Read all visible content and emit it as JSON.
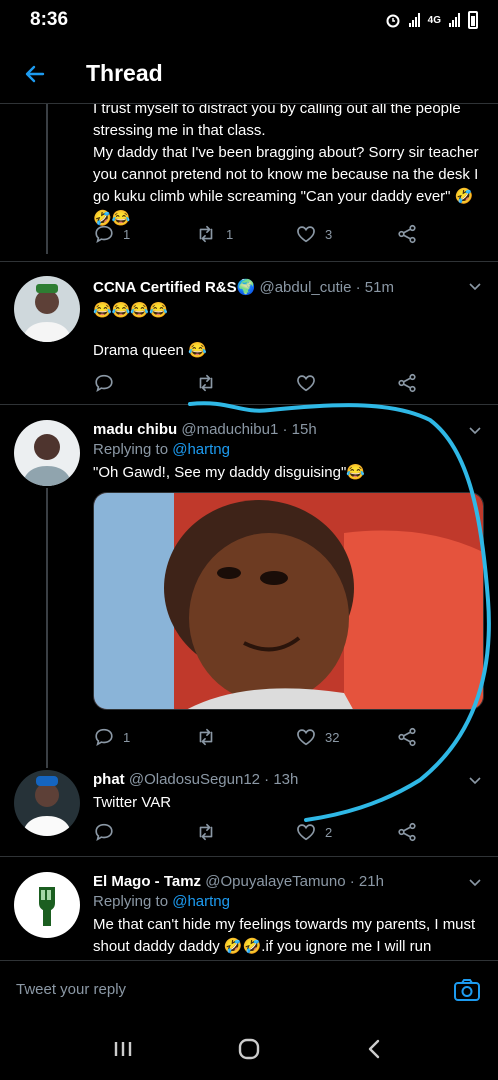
{
  "status_bar": {
    "time": "8:36",
    "network": "4G"
  },
  "header": {
    "title": "Thread"
  },
  "tweets": [
    {
      "text_lines": [
        "I trust myself to distract you by calling out all the people",
        "stressing me in that class.",
        "My daddy that I've been bragging about? Sorry sir teacher",
        "you cannot pretend not to know me because na the desk I",
        "go kuku climb while screaming \"Can your daddy ever\" 🤣",
        "🤣😂"
      ],
      "replies": "1",
      "retweets": "1",
      "likes": "3"
    },
    {
      "name": "CCNA Certified R&S🌍",
      "handle": "@abdul_cutie",
      "time": "· 51m",
      "emoji_line": "😂😂😂😂",
      "text": "Drama queen 😂",
      "replies": "",
      "retweets": "",
      "likes": ""
    },
    {
      "name": "madu chibu",
      "handle": "@maduchibu1",
      "time": "· 15h",
      "replying_prefix": "Replying to ",
      "replying_to": "@hartng",
      "text": "\"Oh Gawd!, See my daddy disguising\"😂",
      "replies": "1",
      "retweets": "",
      "likes": "32"
    },
    {
      "name": "phat",
      "handle": "@OladosuSegun12",
      "time": "· 13h",
      "text": "Twitter VAR",
      "replies": "",
      "retweets": "",
      "likes": "2"
    },
    {
      "name": "El Mago - Tamz",
      "handle": "@OpuyalayeTamuno",
      "time": "· 21h",
      "replying_prefix": "Replying to ",
      "replying_to": "@hartng",
      "text_lines": [
        "Me that can't hide my feelings towards my parents, I must",
        "shout daddy daddy 🤣🤣.if you ignore me I will run"
      ]
    }
  ],
  "reply_bar": {
    "placeholder": "Tweet your reply"
  },
  "colors": {
    "accent": "#1d9bf0",
    "scribble": "#2fb8e6",
    "muted": "#8b98a5",
    "background": "#000000"
  },
  "icons": [
    "back-arrow-icon",
    "reply-icon",
    "retweet-icon",
    "like-icon",
    "share-icon",
    "caret-down-icon",
    "camera-icon",
    "recents-icon",
    "home-icon",
    "back-icon"
  ]
}
